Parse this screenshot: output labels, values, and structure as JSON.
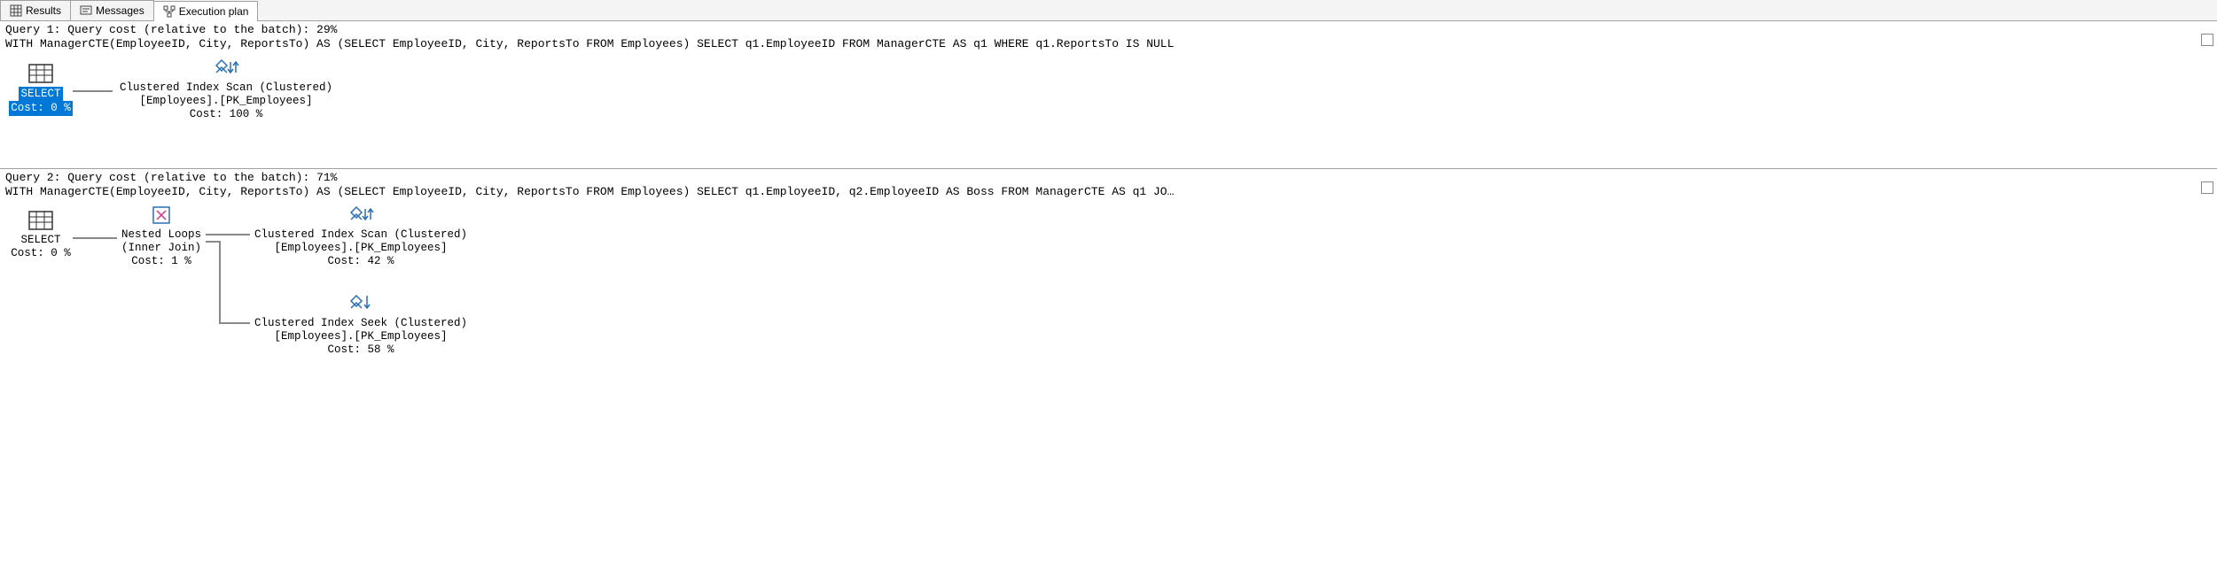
{
  "tabs": {
    "results": "Results",
    "messages": "Messages",
    "execution_plan": "Execution plan"
  },
  "query1": {
    "title": "Query 1: Query cost (relative to the batch): 29%",
    "sql": "WITH ManagerCTE(EmployeeID, City, ReportsTo) AS (SELECT EmployeeID, City, ReportsTo FROM Employees) SELECT q1.EmployeeID FROM ManagerCTE AS q1 WHERE q1.ReportsTo IS NULL",
    "select": {
      "label": "SELECT",
      "cost": "Cost: 0 %"
    },
    "scan": {
      "line1": "Clustered Index Scan (Clustered)",
      "line2": "[Employees].[PK_Employees]",
      "cost": "Cost: 100 %"
    }
  },
  "query2": {
    "title": "Query 2: Query cost (relative to the batch): 71%",
    "sql": "WITH ManagerCTE(EmployeeID, City, ReportsTo) AS (SELECT EmployeeID, City, ReportsTo FROM Employees) SELECT q1.EmployeeID, q2.EmployeeID AS Boss FROM ManagerCTE AS q1 JO…",
    "select": {
      "label": "SELECT",
      "cost": "Cost: 0 %"
    },
    "nested_loops": {
      "line1": "Nested Loops",
      "line2": "(Inner Join)",
      "cost": "Cost: 1 %"
    },
    "scan": {
      "line1": "Clustered Index Scan (Clustered)",
      "line2": "[Employees].[PK_Employees]",
      "cost": "Cost: 42 %"
    },
    "seek": {
      "line1": "Clustered Index Seek (Clustered)",
      "line2": "[Employees].[PK_Employees]",
      "cost": "Cost: 58 %"
    }
  }
}
